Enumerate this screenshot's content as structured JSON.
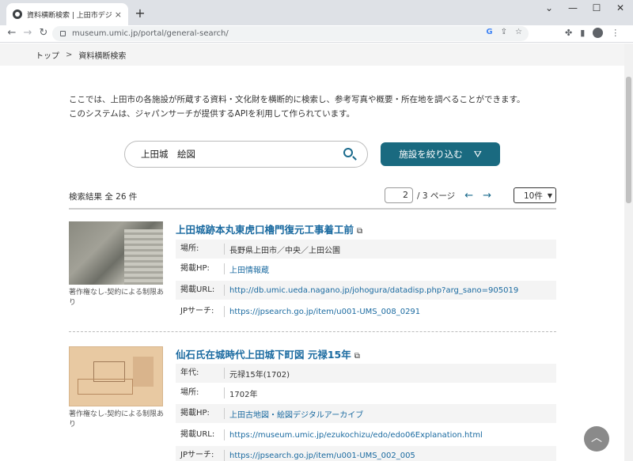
{
  "browser": {
    "tab_title": "資料横断検索 | 上田市デジタルア-",
    "tab_close": "×",
    "new_tab": "+",
    "url": "museum.umic.jp/portal/general-search/",
    "window_controls": [
      "⌄",
      "—",
      "☐",
      "✕"
    ]
  },
  "breadcrumb": {
    "home": "トップ",
    "sep": ">",
    "current": "資料横断検索"
  },
  "intro": {
    "line1": "ここでは、上田市の各施設が所蔵する資料・文化財を横断的に検索し、参考写真や概要・所在地を調べることができます。",
    "line2": "このシステムは、ジャパンサーチが提供するAPIを利用して作られています。"
  },
  "search": {
    "value": "上田城　絵図",
    "filter_label": "施設を絞り込む"
  },
  "results_header": {
    "count_label": "検索結果 全 26 件",
    "current_page": "2",
    "total_pages": "/ 3 ページ",
    "per_page": "10件"
  },
  "results": [
    {
      "title": "上田城跡本丸東虎口櫓門復元工事着工前",
      "copyright": "著作権なし-契約による制限あり",
      "fields": [
        {
          "label": "場所:",
          "value": "長野県上田市／中央／上田公園",
          "link": false
        },
        {
          "label": "掲載HP:",
          "value": "上田情報蔵",
          "link": true
        },
        {
          "label": "掲載URL:",
          "value": "http://db.umic.ueda.nagano.jp/johogura/datadisp.php?arg_sano=905019",
          "link": true
        },
        {
          "label": "JPサーチ:",
          "value": "https://jpsearch.go.jp/item/u001-UMS_008_0291",
          "link": true
        }
      ]
    },
    {
      "title": "仙石氏在城時代上田城下町図 元禄15年",
      "copyright": "著作権なし-契約による制限あり",
      "fields": [
        {
          "label": "年代:",
          "value": "元禄15年(1702)",
          "link": false
        },
        {
          "label": "場所:",
          "value": "1702年",
          "link": false
        },
        {
          "label": "掲載HP:",
          "value": "上田古地図・絵図デジタルアーカイブ",
          "link": true
        },
        {
          "label": "掲載URL:",
          "value": "https://museum.umic.jp/ezukochizu/edo/edo06Explanation.html",
          "link": true
        },
        {
          "label": "JPサーチ:",
          "value": "https://jpsearch.go.jp/item/u001-UMS_002_005",
          "link": true
        }
      ]
    }
  ]
}
